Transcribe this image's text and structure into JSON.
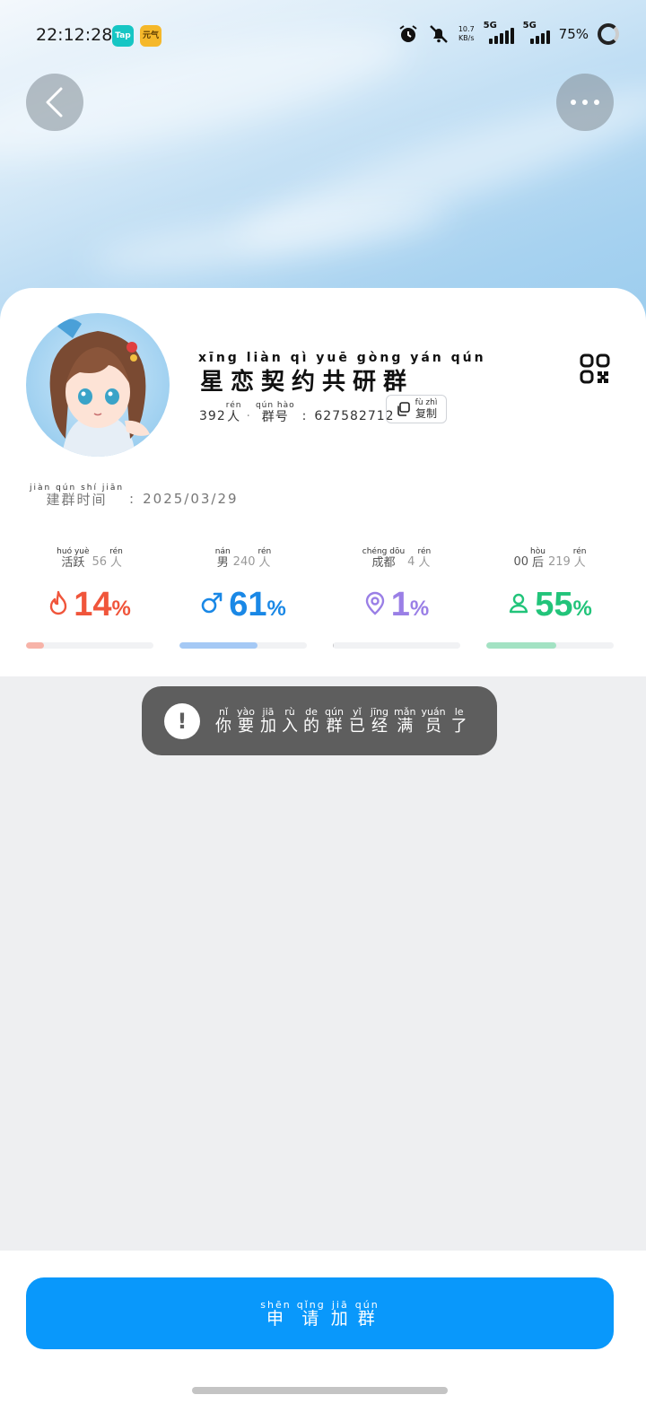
{
  "status_bar": {
    "time": "22:12:28",
    "app1": "Tap",
    "app2": "元气",
    "speed_value": "10.7",
    "speed_unit": "KB/s",
    "net1": "5G",
    "net2": "5G",
    "battery": "75%"
  },
  "nav": {
    "back_icon": "chevron-left-icon",
    "more_icon": "ellipsis-icon"
  },
  "group": {
    "name_pinyin": "xīng liàn qì yuē gòng yán qún",
    "name": "星恋契约共研群",
    "member_count": "392",
    "member_unit": "人",
    "member_unit_py": "rén",
    "id_label": "群号",
    "id_label_py": "qún hào",
    "id_value": "627582712",
    "copy_label": "复制",
    "copy_label_py": "fù zhì",
    "founded_label": "建群时间",
    "founded_label_py": "jiàn qún shí jiān",
    "founded_value": "2025/03/29"
  },
  "stats": [
    {
      "label": "活跃",
      "label_py": "huó yuè",
      "count": "56",
      "unit": "人",
      "unit_py": "rén",
      "value": "14",
      "percent_sign": "%",
      "fraction": 0.14,
      "color": "#f0553b",
      "bar_color": "#f7b3a8",
      "icon": "flame-icon"
    },
    {
      "label": "男",
      "label_py": "nán",
      "count": "240",
      "unit": "人",
      "unit_py": "rén",
      "value": "61",
      "percent_sign": "%",
      "fraction": 0.61,
      "color": "#1a88e6",
      "bar_color": "#a5c9f5",
      "icon": "male-icon"
    },
    {
      "label": "成都",
      "label_py": "chéng dōu",
      "count": "4",
      "unit": "人",
      "unit_py": "rén",
      "value": "1",
      "percent_sign": "%",
      "fraction": 0.01,
      "color": "#9a7fe6",
      "bar_color": "#c9c9cc",
      "icon": "location-pin-icon"
    },
    {
      "label": "后",
      "label_prefix": "00",
      "label_py": "hòu",
      "count": "219",
      "unit": "人",
      "unit_py": "rén",
      "value": "55",
      "percent_sign": "%",
      "fraction": 0.55,
      "color": "#22c47a",
      "bar_color": "#a3e2c3",
      "icon": "person-icon"
    }
  ],
  "toast": {
    "icon": "exclamation-icon",
    "chars": [
      "你",
      "要",
      "加",
      "入",
      "的",
      "群",
      "已",
      "经",
      "满",
      "员",
      "了"
    ],
    "pinyin": [
      "nǐ",
      "yào",
      "jiā",
      "rù",
      "de",
      "qún",
      "yǐ",
      "jīng",
      "mǎn",
      "yuán",
      "le"
    ]
  },
  "join": {
    "chars": [
      "申",
      "请",
      "加",
      "群"
    ],
    "pinyin": [
      "shēn",
      "qǐng",
      "jiā",
      "qún"
    ]
  }
}
